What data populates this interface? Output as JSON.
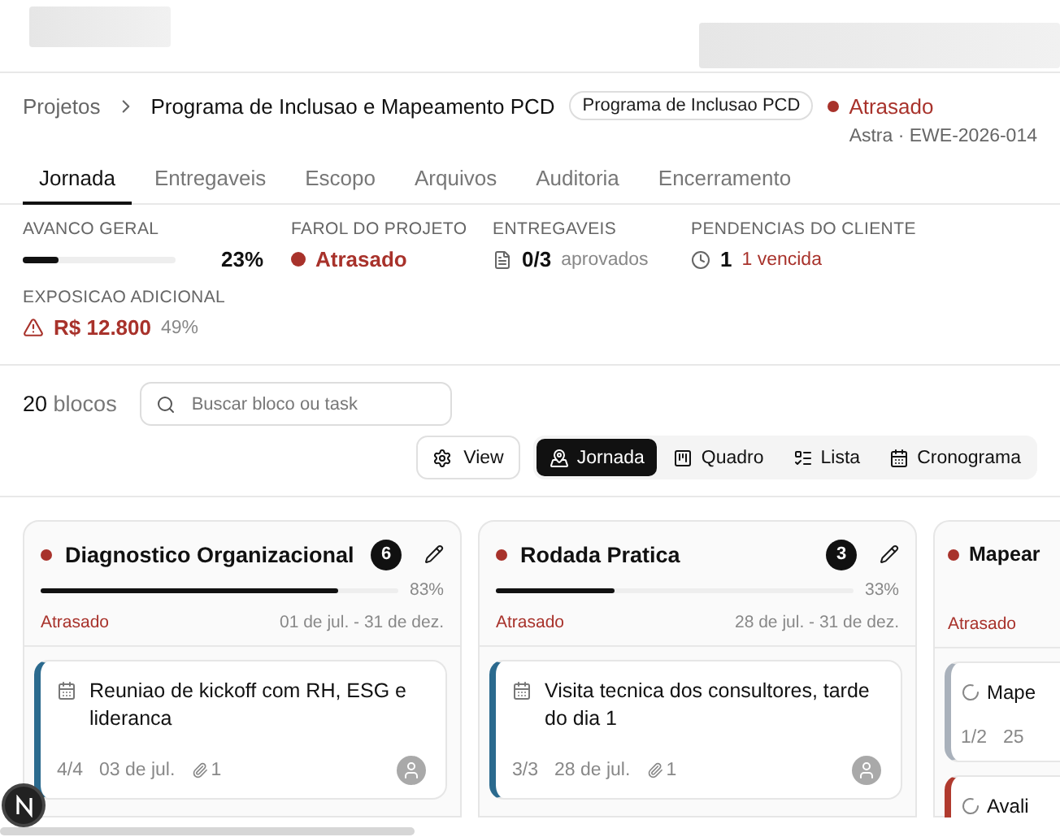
{
  "breadcrumb": {
    "root": "Projetos",
    "current": "Programa de Inclusao e Mapeamento PCD",
    "badge": "Programa de Inclusao PCD",
    "status": "Atrasado"
  },
  "project_meta": "Astra · EWE-2026-014",
  "tabs": [
    {
      "label": "Jornada",
      "selected": true
    },
    {
      "label": "Entregaveis",
      "selected": false
    },
    {
      "label": "Escopo",
      "selected": false
    },
    {
      "label": "Arquivos",
      "selected": false
    },
    {
      "label": "Auditoria",
      "selected": false
    },
    {
      "label": "Encerramento",
      "selected": false
    }
  ],
  "stats": {
    "progress": {
      "label": "AVANCO GERAL",
      "level": 0.23,
      "reading": "23%"
    },
    "status": {
      "label": "FAROL DO PROJETO",
      "value": "Atrasado"
    },
    "deliverables": {
      "label": "ENTREGAVEIS",
      "value": "0/3",
      "note": "aprovados"
    },
    "pending": {
      "label": "PENDENCIAS DO CLIENTE",
      "value": "1",
      "note": "1 vencida"
    },
    "exposure": {
      "label": "EXPOSICAO ADICIONAL",
      "value": "R$ 12.800",
      "note": "49%"
    }
  },
  "toolbar": {
    "count": "20",
    "count_label": "blocos",
    "search_placeholder": "Buscar bloco ou task",
    "view_button": "View",
    "views": [
      {
        "label": "Jornada",
        "kind": "map",
        "selected": true
      },
      {
        "label": "Quadro",
        "kind": "board",
        "selected": false
      },
      {
        "label": "Lista",
        "kind": "list",
        "selected": false
      },
      {
        "label": "Cronograma",
        "kind": "calendar",
        "selected": false
      }
    ]
  },
  "columns": [
    {
      "title": "Diagnostico Organizacional",
      "count": "6",
      "level": 0.83,
      "reading": "83%",
      "status": "Atrasado",
      "dates": "01 de jul. - 31 de dez.",
      "tasks": [
        {
          "kind": "meeting",
          "title": "Reuniao de kickoff com RH, ESG e lideranca",
          "done": "4/4",
          "date": "03 de jul.",
          "attachments": "1",
          "color": "#2b6a8e"
        }
      ]
    },
    {
      "title": "Rodada Pratica",
      "count": "3",
      "level": 0.33,
      "reading": "33%",
      "status": "Atrasado",
      "dates": "28 de jul. - 31 de dez.",
      "tasks": [
        {
          "kind": "meeting",
          "title": "Visita tecnica dos consultores, tarde do dia 1",
          "done": "3/3",
          "date": "28 de jul.",
          "attachments": "1",
          "color": "#2b6a8e"
        }
      ]
    },
    {
      "title": "Mapear",
      "status": "Atrasado",
      "tasks": [
        {
          "kind": "pending",
          "title": "Mape",
          "done": "1/2",
          "date": "25",
          "color": "#a9b1bb"
        },
        {
          "kind": "pending",
          "title": "Avali",
          "color": "#b03a2e"
        }
      ]
    }
  ]
}
